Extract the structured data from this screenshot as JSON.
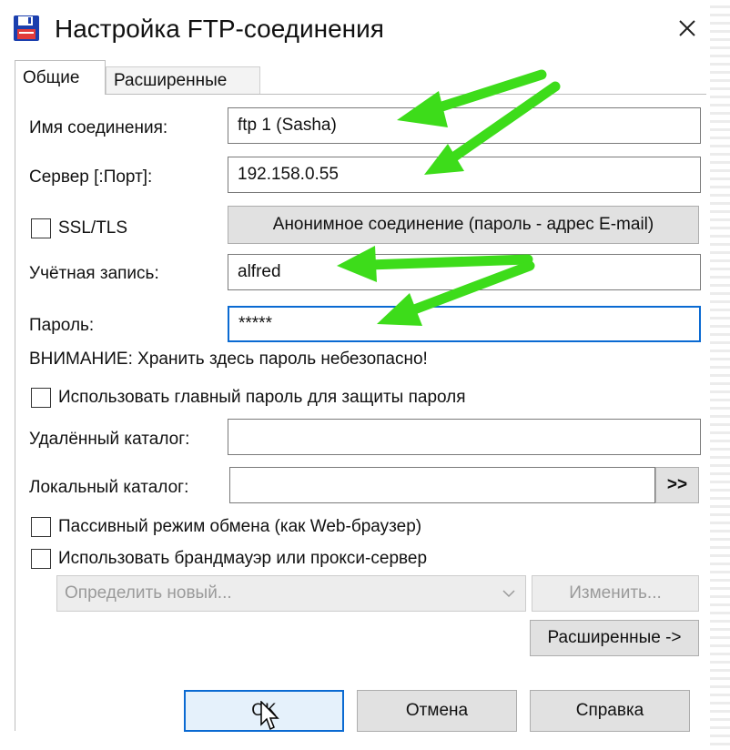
{
  "window": {
    "title": "Настройка FTP-соединения",
    "app_icon": "floppy-disk-icon",
    "close_icon": "close-icon"
  },
  "tabs": [
    {
      "label": "Общие",
      "active": true
    },
    {
      "label": "Расширенные",
      "active": false
    }
  ],
  "form": {
    "connection_name": {
      "label": "Имя соединения:",
      "value": "ftp 1 (Sasha)"
    },
    "server": {
      "label": "Сервер [:Порт]:",
      "value": "192.158.0.55"
    },
    "ssl": {
      "label": "SSL/TLS",
      "checked": false
    },
    "anonymous_button": "Анонимное соединение (пароль - адрес E-mail)",
    "account": {
      "label": "Учётная запись:",
      "value": "alfred"
    },
    "password": {
      "label": "Пароль:",
      "value": "*****"
    },
    "warning": "ВНИМАНИЕ: Хранить здесь пароль небезопасно!",
    "master_password": {
      "label": "Использовать главный пароль для защиты пароля",
      "checked": false
    },
    "remote_dir": {
      "label": "Удалённый каталог:",
      "value": ""
    },
    "local_dir": {
      "label": "Локальный каталог:",
      "value": "",
      "browse": ">>"
    },
    "passive": {
      "label": "Пассивный режим обмена (как Web-браузер)",
      "checked": false
    },
    "firewall": {
      "label": "Использовать брандмауэр или прокси-сервер",
      "checked": false
    },
    "proxy_select": {
      "value": "Определить новый..."
    },
    "change_button": "Изменить...",
    "advanced_button": "Расширенные ->"
  },
  "footer": {
    "ok": "OK",
    "cancel": "Отмена",
    "help": "Справка"
  },
  "colors": {
    "focus_blue": "#0a6ad2",
    "annotation_green": "#3ddc1a"
  }
}
